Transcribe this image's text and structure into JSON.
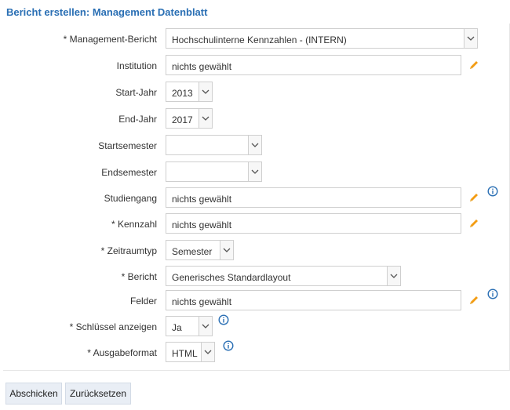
{
  "title": "Bericht erstellen: Management Datenblatt",
  "rows": {
    "management_bericht": {
      "label": "* Management-Bericht",
      "value": "Hochschulinterne Kennzahlen - (INTERN)"
    },
    "institution": {
      "label": "Institution",
      "value": "nichts gewählt"
    },
    "start_jahr": {
      "label": "Start-Jahr",
      "value": "2013"
    },
    "end_jahr": {
      "label": "End-Jahr",
      "value": "2017"
    },
    "startsemester": {
      "label": "Startsemester",
      "value": ""
    },
    "endsemester": {
      "label": "Endsemester",
      "value": ""
    },
    "studiengang": {
      "label": "Studiengang",
      "value": "nichts gewählt"
    },
    "kennzahl": {
      "label": "* Kennzahl",
      "value": "nichts gewählt"
    },
    "zeitraumtyp": {
      "label": "* Zeitraumtyp",
      "value": "Semester"
    },
    "bericht": {
      "label": "* Bericht",
      "value": "Generisches Standardlayout"
    },
    "felder": {
      "label": "Felder",
      "value": "nichts gewählt"
    },
    "schluessel": {
      "label": "* Schlüssel anzeigen",
      "value": "Ja"
    },
    "ausgabeformat": {
      "label": "* Ausgabeformat",
      "value": "HTML"
    }
  },
  "buttons": {
    "submit": "Abschicken",
    "reset": "Zurücksetzen"
  },
  "icons": {
    "edit": "pencil-icon",
    "info": "info-icon",
    "dropdown": "chevron-down-icon"
  },
  "colors": {
    "title": "#2a6fb4",
    "pencil": "#f39c12",
    "info": "#2a6fb4"
  }
}
